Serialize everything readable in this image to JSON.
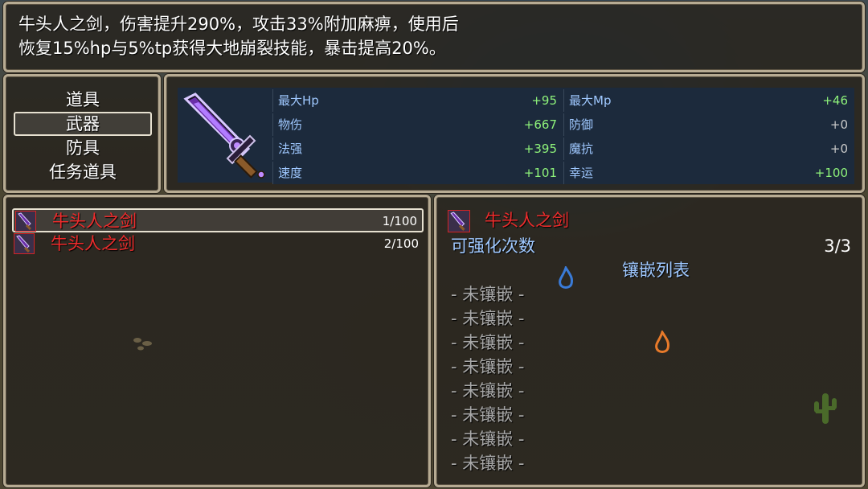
{
  "help": {
    "line1": "牛头人之剑，伤害提升290%，攻击33%附加麻痹，使用后",
    "line2": "恢复15%hp与5%tp获得大地崩裂技能，暴击提高20%。"
  },
  "categories": [
    {
      "label": "道具",
      "selected": false
    },
    {
      "label": "武器",
      "selected": true
    },
    {
      "label": "防具",
      "selected": false
    },
    {
      "label": "任务道具",
      "selected": false
    }
  ],
  "stats": {
    "rows": [
      {
        "left": {
          "label": "最大Hp",
          "value": "+95"
        },
        "right": {
          "label": "最大Mp",
          "value": "+46"
        }
      },
      {
        "left": {
          "label": "物伤",
          "value": "+667"
        },
        "right": {
          "label": "防御",
          "value": "+0"
        }
      },
      {
        "left": {
          "label": "法强",
          "value": "+395"
        },
        "right": {
          "label": "魔抗",
          "value": "+0"
        }
      },
      {
        "left": {
          "label": "速度",
          "value": "+101"
        },
        "right": {
          "label": "幸运",
          "value": "+100"
        }
      }
    ]
  },
  "item_list": [
    {
      "name": "牛头人之剑",
      "count": "1/100",
      "selected": true,
      "icon": "sword-icon"
    },
    {
      "name": "牛头人之剑",
      "count": "2/100",
      "selected": false,
      "icon": "sword-icon"
    }
  ],
  "detail": {
    "name": "牛头人之剑",
    "icon": "sword-icon",
    "enhance_label": "可强化次数",
    "enhance_value": "3/3",
    "socket_title": "镶嵌列表",
    "sockets": [
      "- 未镶嵌 -",
      "- 未镶嵌 -",
      "- 未镶嵌 -",
      "- 未镶嵌 -",
      "- 未镶嵌 -",
      "- 未镶嵌 -",
      "- 未镶嵌 -",
      "- 未镶嵌 -"
    ]
  },
  "colors": {
    "item_name": "#ee2c2c",
    "stat_label": "#9fc8ff",
    "stat_value": "#8ef27a",
    "window_border": "#b7ab93"
  }
}
